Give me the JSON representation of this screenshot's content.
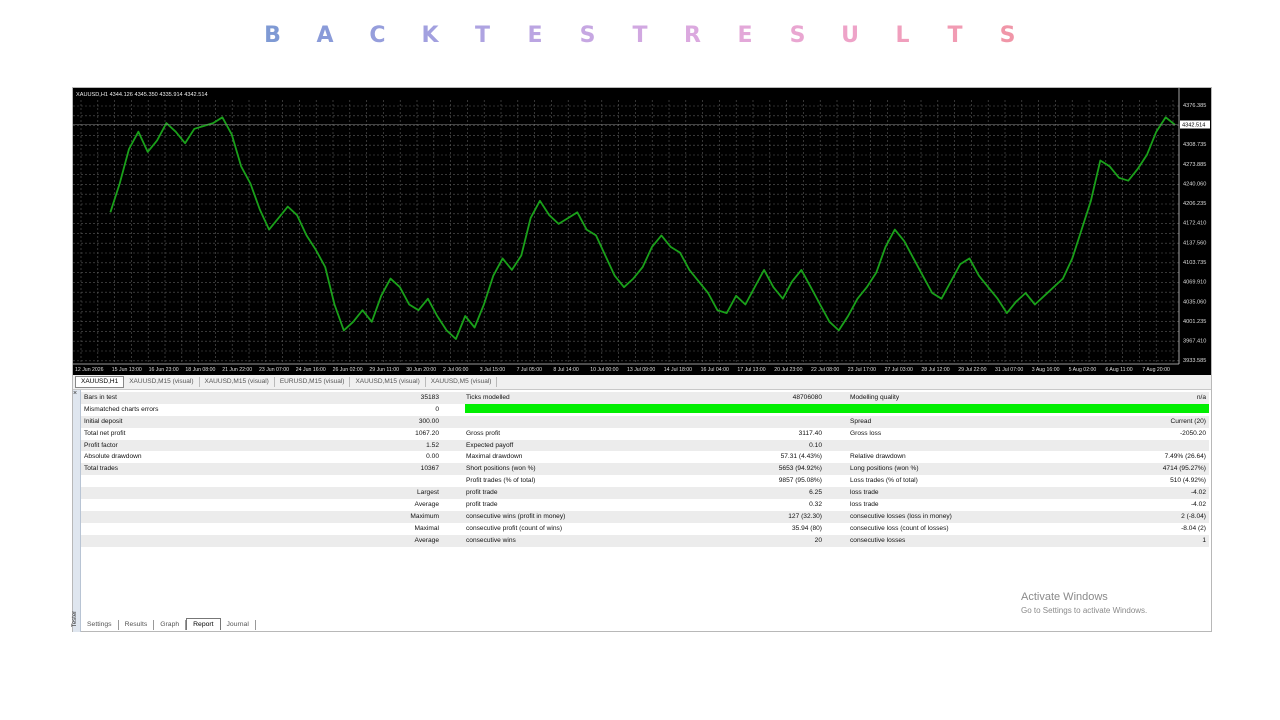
{
  "banner": {
    "letters": [
      "B",
      "A",
      "C",
      "K",
      "T",
      "E",
      "S",
      "T",
      "R",
      "E",
      "S",
      "U",
      "L",
      "T",
      "S"
    ],
    "colors": [
      "#7f9ad4",
      "#8a9bd9",
      "#969edc",
      "#a2a0df",
      "#aea3e1",
      "#bba5e2",
      "#c6a7e2",
      "#d1a8e1",
      "#dba9df",
      "#e3a8d9",
      "#e9a6d1",
      "#eea3c8",
      "#f09fbd",
      "#f19bb3",
      "#f096a8"
    ]
  },
  "chart": {
    "header": "XAUUSD,H1  4344.126 4345.350 4335.914 4342.514",
    "price_labels": [
      "4376.385",
      "4308.735",
      "4273.885",
      "4240.060",
      "4206.235",
      "4172.410",
      "4137.560",
      "4103.735",
      "4069.910",
      "4035.060",
      "4001.235",
      "3967.410",
      "3933.585"
    ],
    "current_price": "4342.514",
    "time_labels": [
      "12 Jun 2026",
      "15 Jun 13:00",
      "16 Jun 23:00",
      "18 Jun 08:00",
      "21 Jun 22:00",
      "23 Jun 07:00",
      "24 Jun 16:00",
      "26 Jun 02:00",
      "29 Jun 11:00",
      "30 Jun 20:00",
      "2 Jul 06:00",
      "3 Jul 15:00",
      "7 Jul 05:00",
      "8 Jul 14:00",
      "10 Jul 00:00",
      "13 Jul 09:00",
      "14 Jul 18:00",
      "16 Jul 04:00",
      "17 Jul 13:00",
      "20 Jul 23:00",
      "22 Jul 08:00",
      "23 Jul 17:00",
      "27 Jul 03:00",
      "28 Jul 12:00",
      "29 Jul 22:00",
      "31 Jul 07:00",
      "3 Aug 16:00",
      "5 Aug 02:00",
      "6 Aug 11:00",
      "7 Aug 20:00"
    ],
    "line_color": "#1aa01a",
    "grid_color": "#5a5a5a",
    "price_path": [
      [
        12,
        4190
      ],
      [
        15,
        4240
      ],
      [
        18,
        4300
      ],
      [
        21,
        4330
      ],
      [
        24,
        4295
      ],
      [
        27,
        4315
      ],
      [
        30,
        4345
      ],
      [
        33,
        4330
      ],
      [
        36,
        4310
      ],
      [
        39,
        4335
      ],
      [
        42,
        4340
      ],
      [
        45,
        4345
      ],
      [
        48,
        4355
      ],
      [
        51,
        4325
      ],
      [
        54,
        4270
      ],
      [
        57,
        4240
      ],
      [
        60,
        4195
      ],
      [
        63,
        4160
      ],
      [
        66,
        4180
      ],
      [
        69,
        4200
      ],
      [
        72,
        4185
      ],
      [
        75,
        4150
      ],
      [
        78,
        4125
      ],
      [
        81,
        4095
      ],
      [
        84,
        4030
      ],
      [
        87,
        3985
      ],
      [
        90,
        4000
      ],
      [
        93,
        4020
      ],
      [
        96,
        4000
      ],
      [
        99,
        4045
      ],
      [
        102,
        4075
      ],
      [
        105,
        4060
      ],
      [
        108,
        4030
      ],
      [
        111,
        4020
      ],
      [
        114,
        4040
      ],
      [
        117,
        4010
      ],
      [
        120,
        3985
      ],
      [
        123,
        3970
      ],
      [
        126,
        4010
      ],
      [
        129,
        3990
      ],
      [
        132,
        4030
      ],
      [
        135,
        4080
      ],
      [
        138,
        4110
      ],
      [
        141,
        4090
      ],
      [
        144,
        4115
      ],
      [
        147,
        4180
      ],
      [
        150,
        4210
      ],
      [
        153,
        4185
      ],
      [
        156,
        4170
      ],
      [
        159,
        4180
      ],
      [
        162,
        4190
      ],
      [
        165,
        4160
      ],
      [
        168,
        4150
      ],
      [
        171,
        4115
      ],
      [
        174,
        4080
      ],
      [
        177,
        4060
      ],
      [
        180,
        4075
      ],
      [
        183,
        4095
      ],
      [
        186,
        4130
      ],
      [
        189,
        4150
      ],
      [
        192,
        4130
      ],
      [
        195,
        4120
      ],
      [
        198,
        4090
      ],
      [
        201,
        4070
      ],
      [
        204,
        4050
      ],
      [
        207,
        4020
      ],
      [
        210,
        4015
      ],
      [
        213,
        4045
      ],
      [
        216,
        4030
      ],
      [
        219,
        4060
      ],
      [
        222,
        4090
      ],
      [
        225,
        4060
      ],
      [
        228,
        4040
      ],
      [
        231,
        4070
      ],
      [
        234,
        4090
      ],
      [
        237,
        4060
      ],
      [
        240,
        4030
      ],
      [
        243,
        4000
      ],
      [
        246,
        3985
      ],
      [
        249,
        4010
      ],
      [
        252,
        4040
      ],
      [
        255,
        4060
      ],
      [
        258,
        4085
      ],
      [
        261,
        4130
      ],
      [
        264,
        4160
      ],
      [
        267,
        4140
      ],
      [
        270,
        4110
      ],
      [
        273,
        4080
      ],
      [
        276,
        4050
      ],
      [
        279,
        4040
      ],
      [
        282,
        4070
      ],
      [
        285,
        4100
      ],
      [
        288,
        4110
      ],
      [
        291,
        4080
      ],
      [
        294,
        4060
      ],
      [
        297,
        4040
      ],
      [
        300,
        4015
      ],
      [
        303,
        4035
      ],
      [
        306,
        4050
      ],
      [
        309,
        4030
      ],
      [
        312,
        4045
      ],
      [
        315,
        4060
      ],
      [
        318,
        4075
      ],
      [
        321,
        4110
      ],
      [
        324,
        4160
      ],
      [
        327,
        4210
      ],
      [
        330,
        4280
      ],
      [
        333,
        4270
      ],
      [
        336,
        4250
      ],
      [
        339,
        4245
      ],
      [
        342,
        4265
      ],
      [
        345,
        4290
      ],
      [
        348,
        4330
      ],
      [
        351,
        4355
      ],
      [
        354,
        4342
      ]
    ]
  },
  "chart_tabs": [
    "XAUUSD,H1",
    "XAUUSD,M15 (visual)",
    "XAUUSD,M15 (visual)",
    "EURUSD,M15 (visual)",
    "XAUUSD,M15 (visual)",
    "XAUUSD,M5 (visual)"
  ],
  "report": [
    {
      "c1": "Bars in test",
      "c2": "35183",
      "c3": "Ticks modelled",
      "c4": "48706080",
      "c5": "Modelling quality",
      "c6": "n/a"
    },
    {
      "c1": "Mismatched charts errors",
      "c2": "0",
      "c3": "",
      "c4": "",
      "c5": "",
      "c6": ""
    },
    {
      "c1": "Initial deposit",
      "c2": "300.00",
      "c3": "",
      "c4": "",
      "c5": "Spread",
      "c6": "Current (20)"
    },
    {
      "c1": "Total net profit",
      "c2": "1067.20",
      "c3": "Gross profit",
      "c4": "3117.40",
      "c5": "Gross loss",
      "c6": "-2050.20"
    },
    {
      "c1": "Profit factor",
      "c2": "1.52",
      "c3": "Expected payoff",
      "c4": "0.10",
      "c5": "",
      "c6": ""
    },
    {
      "c1": "Absolute drawdown",
      "c2": "0.00",
      "c3": "Maximal drawdown",
      "c4": "57.31 (4.43%)",
      "c5": "Relative drawdown",
      "c6": "7.49% (26.64)"
    },
    {
      "c1": "Total trades",
      "c2": "10367",
      "c3": "Short positions (won %)",
      "c4": "5653 (94.92%)",
      "c5": "Long positions (won %)",
      "c6": "4714 (95.27%)"
    },
    {
      "c1": "",
      "c2": "",
      "c3": "Profit trades (% of total)",
      "c4": "9857 (95.08%)",
      "c5": "Loss trades (% of total)",
      "c6": "510 (4.92%)"
    },
    {
      "c1": "",
      "c2": "Largest",
      "c3": "profit trade",
      "c4": "6.25",
      "c5": "loss trade",
      "c6": "-4.02"
    },
    {
      "c1": "",
      "c2": "Average",
      "c3": "profit trade",
      "c4": "0.32",
      "c5": "loss trade",
      "c6": "-4.02"
    },
    {
      "c1": "",
      "c2": "Maximum",
      "c3": "consecutive wins (profit in money)",
      "c4": "127 (32.30)",
      "c5": "consecutive losses (loss in money)",
      "c6": "2 (-8.04)"
    },
    {
      "c1": "",
      "c2": "Maximal",
      "c3": "consecutive profit (count of wins)",
      "c4": "35.94 (80)",
      "c5": "consecutive loss (count of losses)",
      "c6": "-8.04 (2)"
    },
    {
      "c1": "",
      "c2": "Average",
      "c3": "consecutive wins",
      "c4": "20",
      "c5": "consecutive losses",
      "c6": "1"
    }
  ],
  "modelling_quality_bar_color": "#00ee00",
  "bottom_tabs": [
    "Settings",
    "Results",
    "Graph",
    "Report",
    "Journal"
  ],
  "active_bottom_tab": "Report",
  "side_label": "Tester",
  "close_glyph": "×",
  "activate": {
    "title": "Activate Windows",
    "subtitle": "Go to Settings to activate Windows."
  }
}
